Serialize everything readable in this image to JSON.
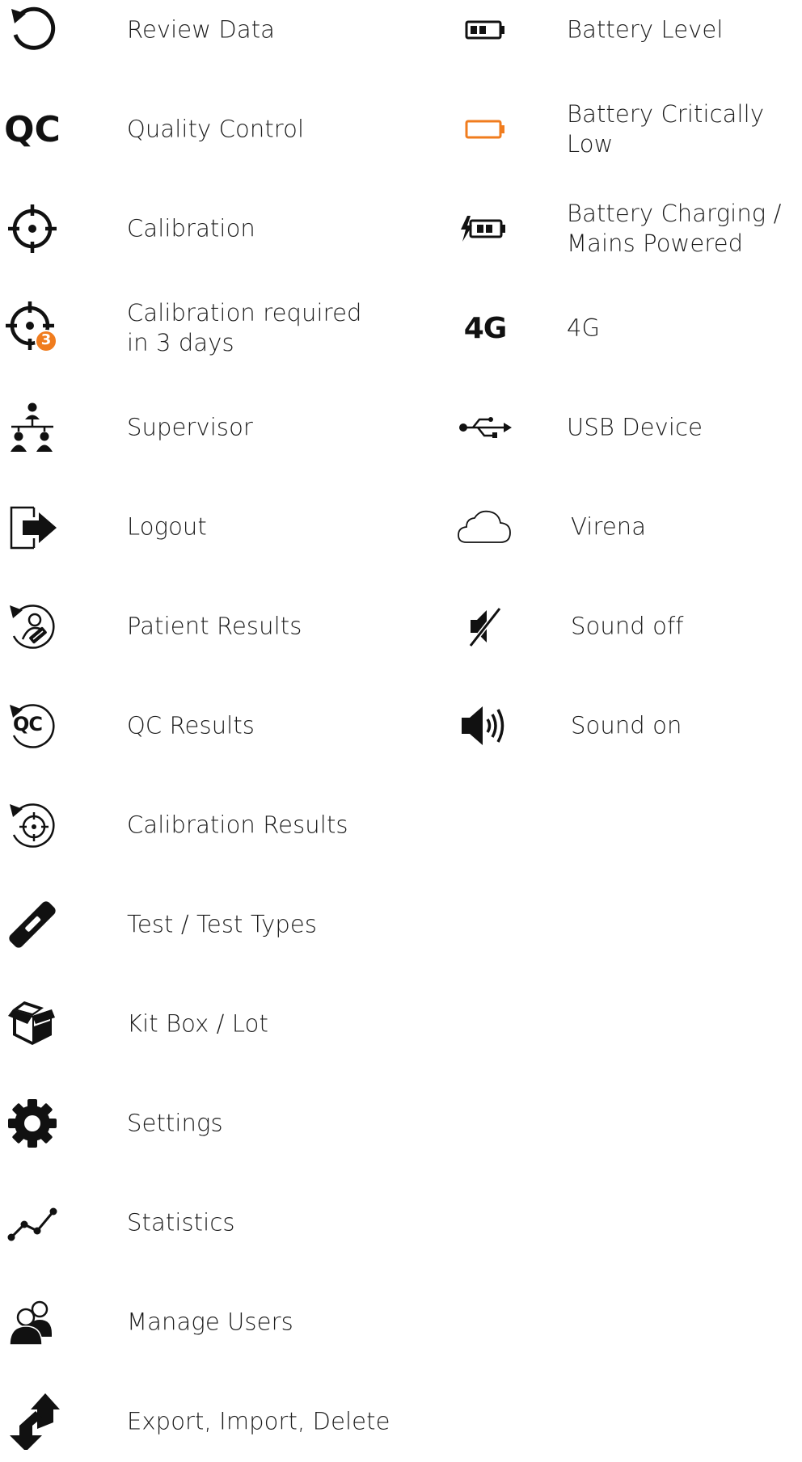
{
  "accent_color": "#f07c1e",
  "text_color": "#1c1c1c",
  "left_column": [
    {
      "icon": "review-data-icon",
      "label": "Review Data"
    },
    {
      "icon": "qc-icon",
      "icon_text": "QC",
      "label": "Quality Control"
    },
    {
      "icon": "crosshair-icon",
      "label": "Calibration"
    },
    {
      "icon": "crosshair-badge-icon",
      "badge": "3",
      "label": "Calibration required\nin 3 days"
    },
    {
      "icon": "supervisor-icon",
      "label": "Supervisor"
    },
    {
      "icon": "logout-icon",
      "label": "Logout"
    },
    {
      "icon": "patient-results-icon",
      "label": "Patient Results"
    },
    {
      "icon": "qc-results-icon",
      "icon_text": "QC",
      "label": "QC Results"
    },
    {
      "icon": "calibration-results-icon",
      "label": "Calibration Results"
    },
    {
      "icon": "test-strip-icon",
      "label": "Test / Test Types"
    },
    {
      "icon": "kit-box-icon",
      "label": "Kit Box / Lot"
    },
    {
      "icon": "gear-icon",
      "label": "Settings"
    },
    {
      "icon": "statistics-icon",
      "label": "Statistics"
    },
    {
      "icon": "manage-users-icon",
      "label": "Manage Users"
    },
    {
      "icon": "export-import-icon",
      "label": "Export, Import, Delete"
    }
  ],
  "right_column": [
    {
      "icon": "battery-level-icon",
      "label": "Battery Level"
    },
    {
      "icon": "battery-low-icon",
      "label": "Battery Critically Low"
    },
    {
      "icon": "battery-charging-icon",
      "label": "Battery Charging /\nMains Powered"
    },
    {
      "icon": "4g-icon",
      "icon_text": "4G",
      "label": "4G"
    },
    {
      "icon": "usb-icon",
      "label": "USB Device"
    },
    {
      "icon": "cloud-icon",
      "label": "Virena"
    },
    {
      "icon": "sound-off-icon",
      "label": "Sound off"
    },
    {
      "icon": "sound-on-icon",
      "label": "Sound on"
    }
  ]
}
